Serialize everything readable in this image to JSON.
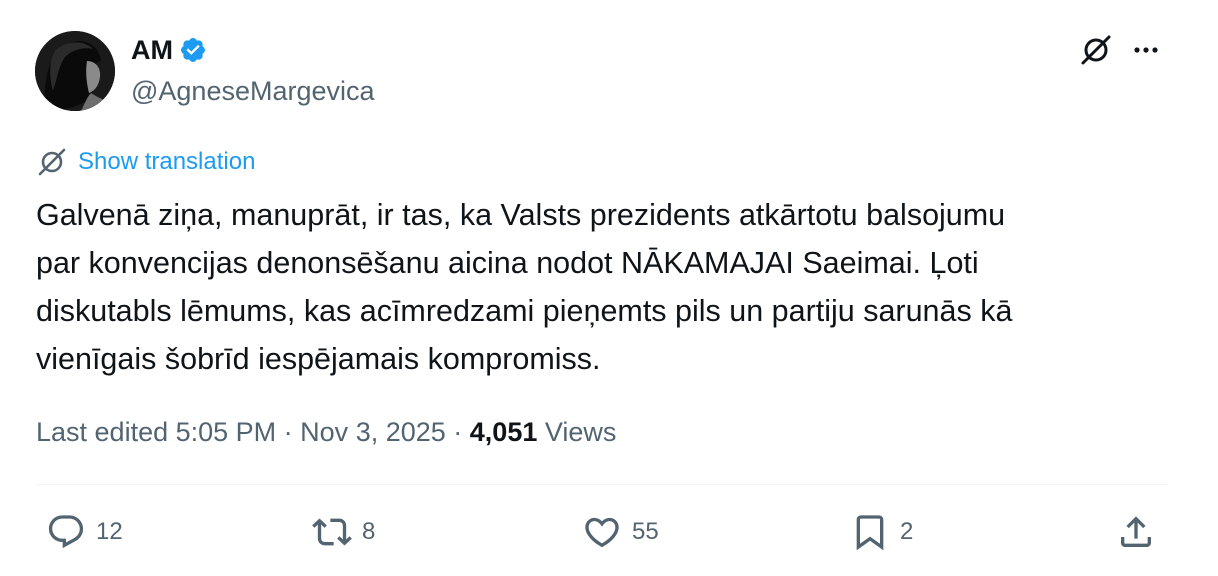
{
  "author": {
    "display_name": "AM",
    "handle": "@AgneseMargevica",
    "verified": true
  },
  "header_icons": [
    "grok-icon",
    "more-icon"
  ],
  "translation": {
    "label": "Show translation"
  },
  "tweet": {
    "lines": [
      "Galvenā ziņa, manuprāt, ir tas, ka Valsts prezidents atkārtotu balsojumu",
      "par konvencijas denonsēšanu aicina nodot NĀKAMAJAI Saeimai. Ļoti",
      "diskutabls lēmums, kas acīmredzami pieņemts pils un partiju sarunās kā",
      "vienīgais šobrīd iespējamais kompromiss."
    ]
  },
  "meta": {
    "edited_prefix": "Last edited ",
    "time": "5:05 PM",
    "separator": " · ",
    "date": "Nov 3, 2025",
    "views_count": "4,051",
    "views_label": " Views"
  },
  "actions": {
    "reply": {
      "icon": "reply-icon",
      "count": "12"
    },
    "retweet": {
      "icon": "retweet-icon",
      "count": "8"
    },
    "like": {
      "icon": "heart-icon",
      "count": "55"
    },
    "bookmark": {
      "icon": "bookmark-icon",
      "count": "2"
    },
    "share": {
      "icon": "share-icon"
    }
  },
  "colors": {
    "text_primary": "#0f1419",
    "text_secondary": "#536471",
    "accent": "#1d9bf0",
    "divider": "#eff3f4"
  }
}
